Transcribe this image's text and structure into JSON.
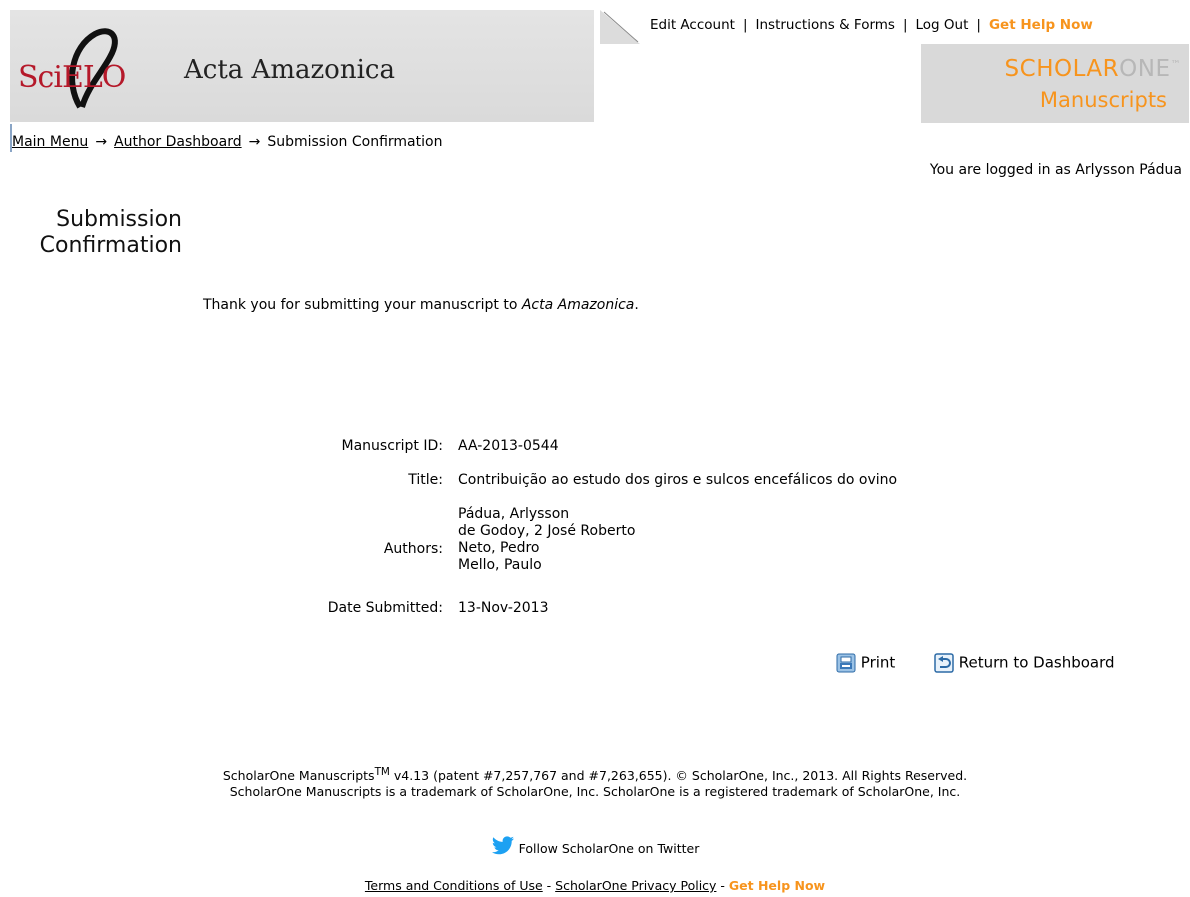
{
  "header": {
    "logo_text": "SciELO",
    "journal_title": "Acta Amazonica",
    "scholarone_logo": {
      "line1_a": "SCHOLAR",
      "line1_b": "ONE",
      "tm": "™",
      "line2": "Manuscripts"
    }
  },
  "top_nav": {
    "edit_account": "Edit Account",
    "instructions": "Instructions & Forms",
    "log_out": "Log Out",
    "get_help": "Get Help Now",
    "separator": "|"
  },
  "breadcrumb": {
    "items": [
      "Main Menu",
      "Author Dashboard",
      "Submission Confirmation"
    ],
    "arrow": "→"
  },
  "logged_in": "You are logged in as Arlysson Pádua",
  "page_title": {
    "line1": "Submission",
    "line2": "Confirmation"
  },
  "thanks": {
    "prefix": "Thank you for submitting your manuscript to ",
    "journal": "Acta Amazonica",
    "suffix": "."
  },
  "details": {
    "manuscript_id_label": "Manuscript ID:",
    "manuscript_id": "AA-2013-0544",
    "title_label": "Title:",
    "title": "Contribuição ao estudo dos giros e sulcos encefálicos do ovino",
    "authors_label": "Authors:",
    "authors": [
      "Pádua, Arlysson",
      "de Godoy, 2 José Roberto",
      "Neto, Pedro",
      "Mello, Paulo"
    ],
    "date_label": "Date Submitted:",
    "date": "13-Nov-2013"
  },
  "actions": {
    "print": "Print",
    "return": "Return to Dashboard"
  },
  "footer": {
    "line1_a": "ScholarOne Manuscripts",
    "line1_tm": "TM",
    "line1_b": " v4.13 (patent #7,257,767 and #7,263,655). © ScholarOne, Inc., 2013. All Rights Reserved.",
    "line2": "ScholarOne Manuscripts is a trademark of ScholarOne, Inc. ScholarOne is a registered trademark of ScholarOne, Inc.",
    "twitter": "Follow ScholarOne on Twitter",
    "terms": "Terms and Conditions of Use",
    "privacy": "ScholarOne Privacy Policy",
    "get_help": "Get Help Now",
    "dash": " - "
  },
  "colors": {
    "accent_orange": "#f7941d",
    "scielo_red": "#b5192a",
    "twitter_blue": "#1da1f2"
  }
}
